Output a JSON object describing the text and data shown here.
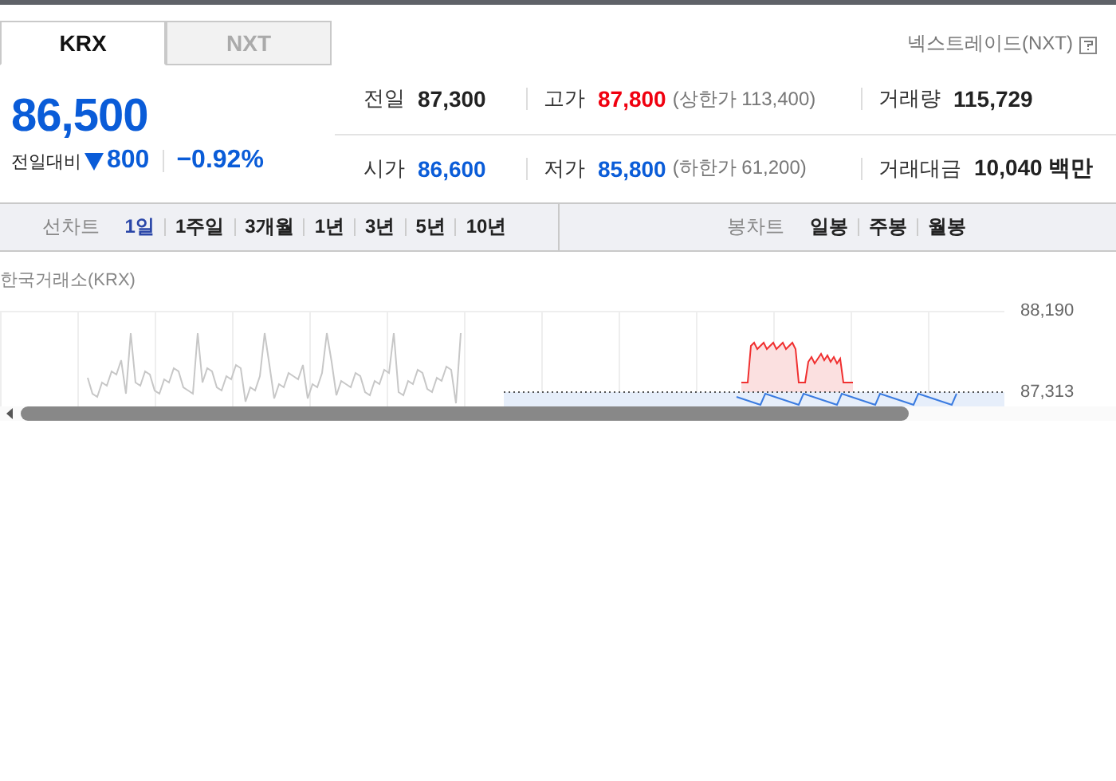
{
  "market_tabs": [
    {
      "label": "KRX",
      "selected": true
    },
    {
      "label": "NXT",
      "selected": false
    }
  ],
  "nxt_link": "넥스트레이드(NXT)",
  "quote": {
    "price": "86,500",
    "falling": true,
    "color": "#0a5cd8",
    "change_label": "전일대비",
    "change": "800",
    "change_rate": "−0.92%"
  },
  "stats": [
    [
      {
        "label": "전일",
        "value": "87,300",
        "color": "#222222"
      },
      {
        "label": "고가",
        "value": "87,800",
        "color": "#f0000f",
        "note": "(상한가 113,400)"
      },
      {
        "label": "거래량",
        "value": "115,729",
        "color": "#222222"
      }
    ],
    [
      {
        "label": "시가",
        "value": "86,600",
        "color": "#0a5cd8"
      },
      {
        "label": "저가",
        "value": "85,800",
        "color": "#0a5cd8",
        "note": "(하한가 61,200)"
      },
      {
        "label": "거래대금",
        "value": "10,040 백만",
        "color": "#222222"
      }
    ]
  ],
  "line_chart_tabs": {
    "title": "선차트",
    "items": [
      {
        "label": "1일",
        "selected": true
      },
      {
        "label": "1주일",
        "selected": false
      },
      {
        "label": "3개월",
        "selected": false
      },
      {
        "label": "1년",
        "selected": false
      },
      {
        "label": "3년",
        "selected": false
      },
      {
        "label": "5년",
        "selected": false
      },
      {
        "label": "10년",
        "selected": false
      }
    ]
  },
  "candle_chart_tabs": {
    "title": "봉차트",
    "items": [
      {
        "label": "일봉",
        "selected": false
      },
      {
        "label": "주봉",
        "selected": false
      },
      {
        "label": "월봉",
        "selected": false
      }
    ]
  },
  "chart": {
    "source": "한국거래소(KRX)",
    "y_labels": [
      "88,190",
      "87,313"
    ]
  }
}
